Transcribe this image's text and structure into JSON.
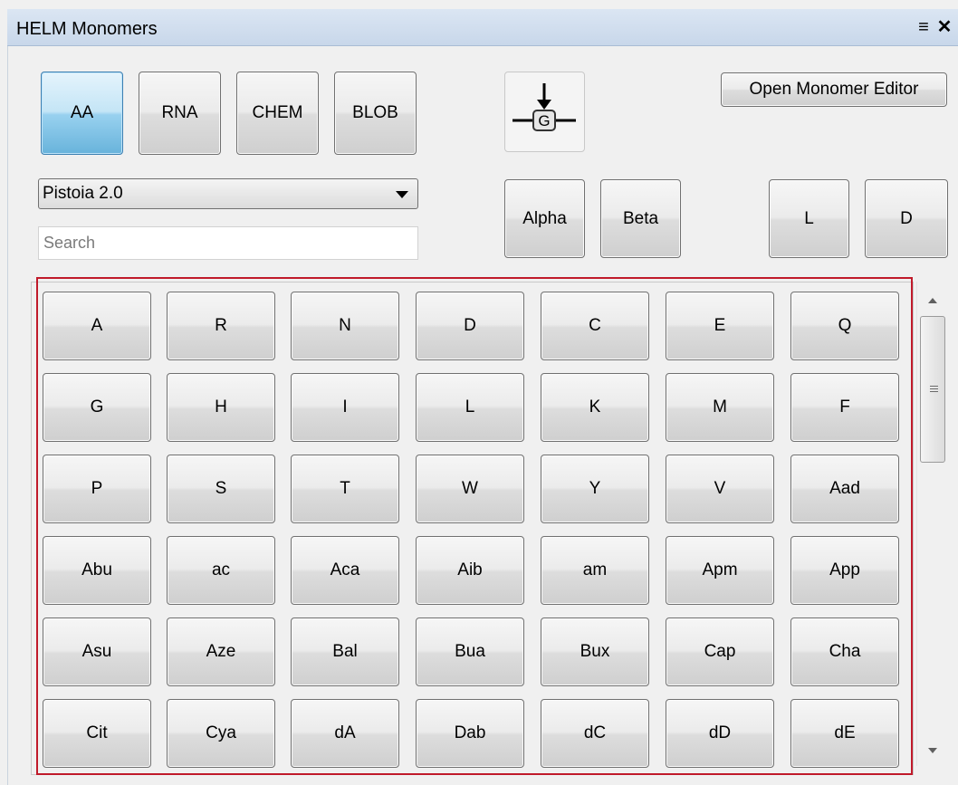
{
  "window": {
    "title": "HELM Monomers",
    "menu_icon": "≡",
    "close_icon": "✕"
  },
  "type_tabs": [
    {
      "label": "AA",
      "active": true
    },
    {
      "label": "RNA",
      "active": false
    },
    {
      "label": "CHEM",
      "active": false
    },
    {
      "label": "BLOB",
      "active": false
    }
  ],
  "open_editor_label": "Open Monomer Editor",
  "monomer_icon_letter": "G",
  "library_select": {
    "value": "Pistoia 2.0"
  },
  "search": {
    "placeholder": "Search",
    "value": ""
  },
  "backbone_buttons": [
    "Alpha",
    "Beta"
  ],
  "chirality_buttons": [
    "L",
    "D"
  ],
  "monomers": [
    [
      "A",
      "R",
      "N",
      "D",
      "C",
      "E",
      "Q"
    ],
    [
      "G",
      "H",
      "I",
      "L",
      "K",
      "M",
      "F"
    ],
    [
      "P",
      "S",
      "T",
      "W",
      "Y",
      "V",
      "Aad"
    ],
    [
      "Abu",
      "ac",
      "Aca",
      "Aib",
      "am",
      "Apm",
      "App"
    ],
    [
      "Asu",
      "Aze",
      "Bal",
      "Bua",
      "Bux",
      "Cap",
      "Cha"
    ],
    [
      "Cit",
      "Cya",
      "dA",
      "Dab",
      "dC",
      "dD",
      "dE"
    ]
  ],
  "colors": {
    "active_tab": "#68b3db",
    "highlight_border": "#c01a2a",
    "titlebar": "#c8d7ea"
  }
}
